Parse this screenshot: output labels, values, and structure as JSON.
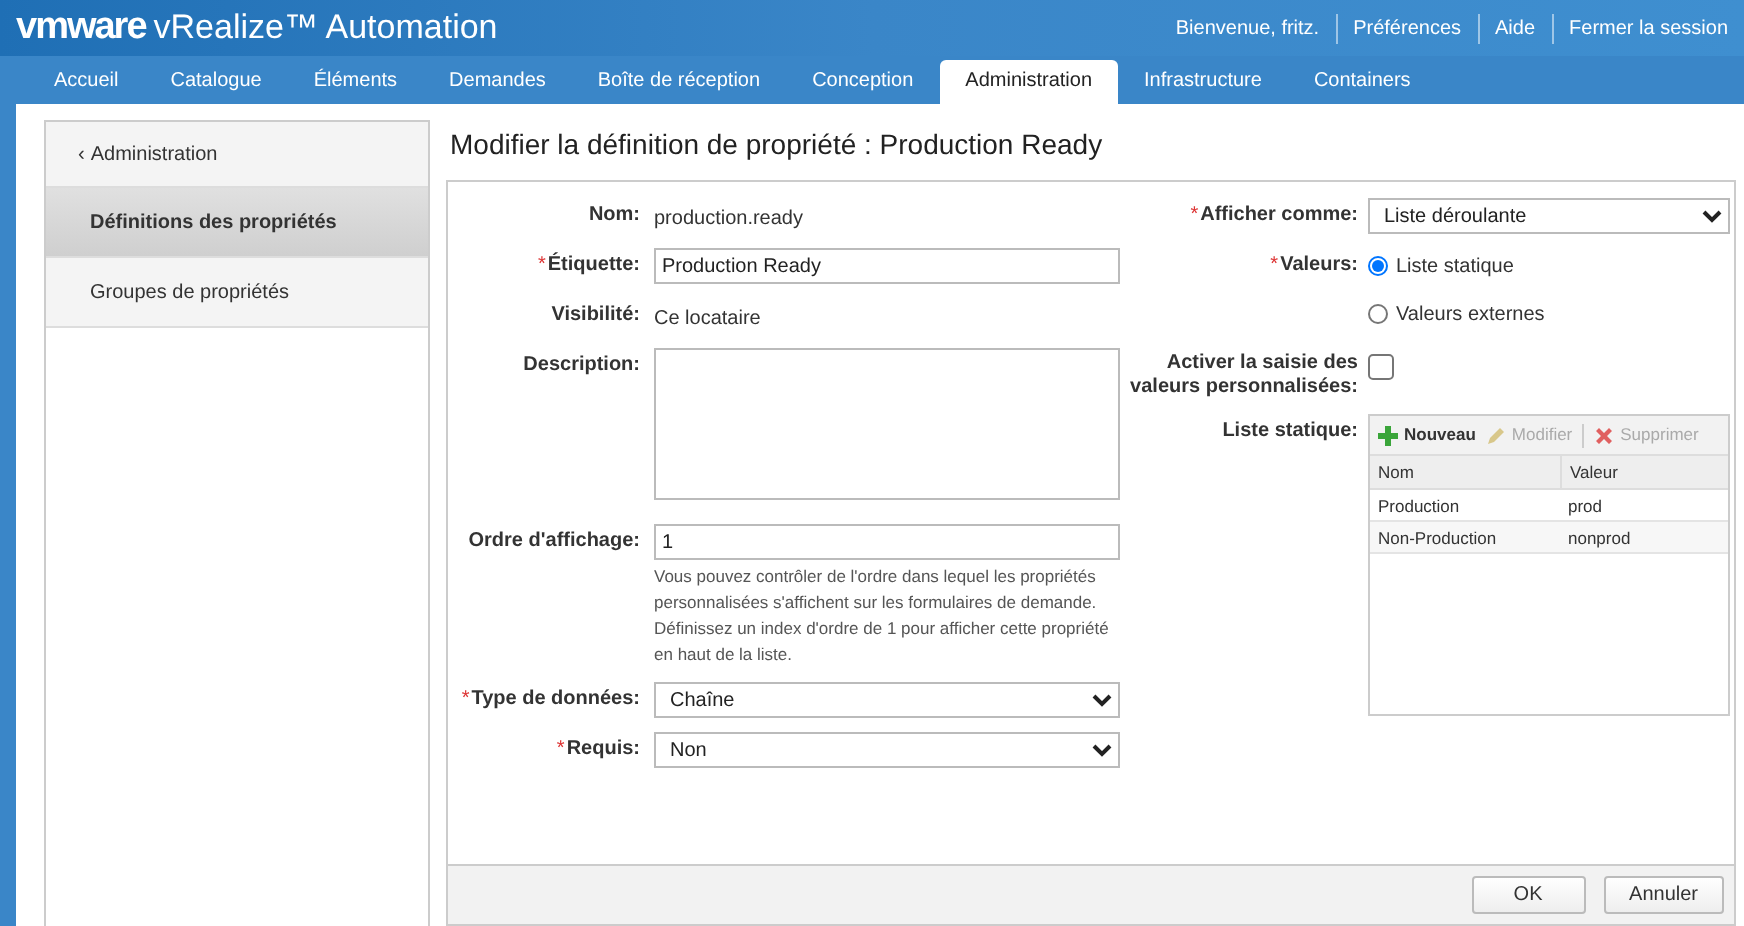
{
  "header": {
    "logo": "vmware",
    "product": "vRealize™ Automation",
    "user_links": [
      "Bienvenue, fritz.",
      "Préférences",
      "Aide",
      "Fermer la session"
    ]
  },
  "tabs": [
    {
      "label": "Accueil",
      "selected": false
    },
    {
      "label": "Catalogue",
      "selected": false
    },
    {
      "label": "Éléments",
      "selected": false
    },
    {
      "label": "Demandes",
      "selected": false
    },
    {
      "label": "Boîte de réception",
      "selected": false
    },
    {
      "label": "Conception",
      "selected": false
    },
    {
      "label": "Administration",
      "selected": true
    },
    {
      "label": "Infrastructure",
      "selected": false
    },
    {
      "label": "Containers",
      "selected": false
    }
  ],
  "sidebar": {
    "back_icon": "‹",
    "back_link": "Administration",
    "items": [
      {
        "label": "Définitions des propriétés",
        "selected": true
      },
      {
        "label": "Groupes de propriétés",
        "selected": false
      }
    ]
  },
  "page_title": "Modifier la définition de propriété : Production Ready",
  "left_fields": [
    {
      "kind": "text",
      "label": "Nom:",
      "value": "production.ready"
    },
    {
      "kind": "input",
      "label": "Étiquette:",
      "required_mark": "*",
      "value": "Production Ready"
    },
    {
      "kind": "text",
      "label": "Visibilité:",
      "value": "Ce locataire"
    },
    {
      "kind": "textarea",
      "label": "Description:"
    },
    {
      "kind": "number",
      "label": "Ordre d'affichage:",
      "value": "1",
      "help": "Vous pouvez contrôler de l'ordre dans lequel les propriétés personnalisées s'affichent sur les formulaires de demande. Définissez un index d'ordre de 1 pour afficher cette propriété en haut de la liste."
    },
    {
      "kind": "select",
      "label": "Type de données:",
      "required_mark": "*",
      "value": "Chaîne"
    },
    {
      "kind": "select",
      "label": "Requis:",
      "required_mark": "*",
      "value": "Non"
    }
  ],
  "right_fields": [
    {
      "kind": "select",
      "label": "Afficher comme:",
      "required_mark": "*",
      "value": "Liste déroulante"
    },
    {
      "kind": "radio",
      "label": "Valeurs:",
      "required_mark": "*",
      "options": [
        {
          "label": "Liste statique",
          "selected": true
        },
        {
          "label": "Valeurs externes",
          "selected": false
        }
      ]
    },
    {
      "kind": "checkbox",
      "label": "Activer la saisie des valeurs personnalisées:",
      "checked": false
    },
    {
      "kind": "list",
      "label": "Liste statique:",
      "toolbar": [
        {
          "kind": "add",
          "label": "Nouveau",
          "disabled": false
        },
        {
          "kind": "edit",
          "label": "Modifier",
          "disabled": true
        },
        {
          "kind": "delete",
          "label": "Supprimer",
          "disabled": true
        }
      ],
      "columns": [
        "Nom",
        "Valeur"
      ],
      "rows": [
        [
          "Production",
          "prod"
        ],
        [
          "Non-Production",
          "nonprod"
        ]
      ]
    }
  ],
  "buttons": [
    "OK",
    "Annuler"
  ]
}
